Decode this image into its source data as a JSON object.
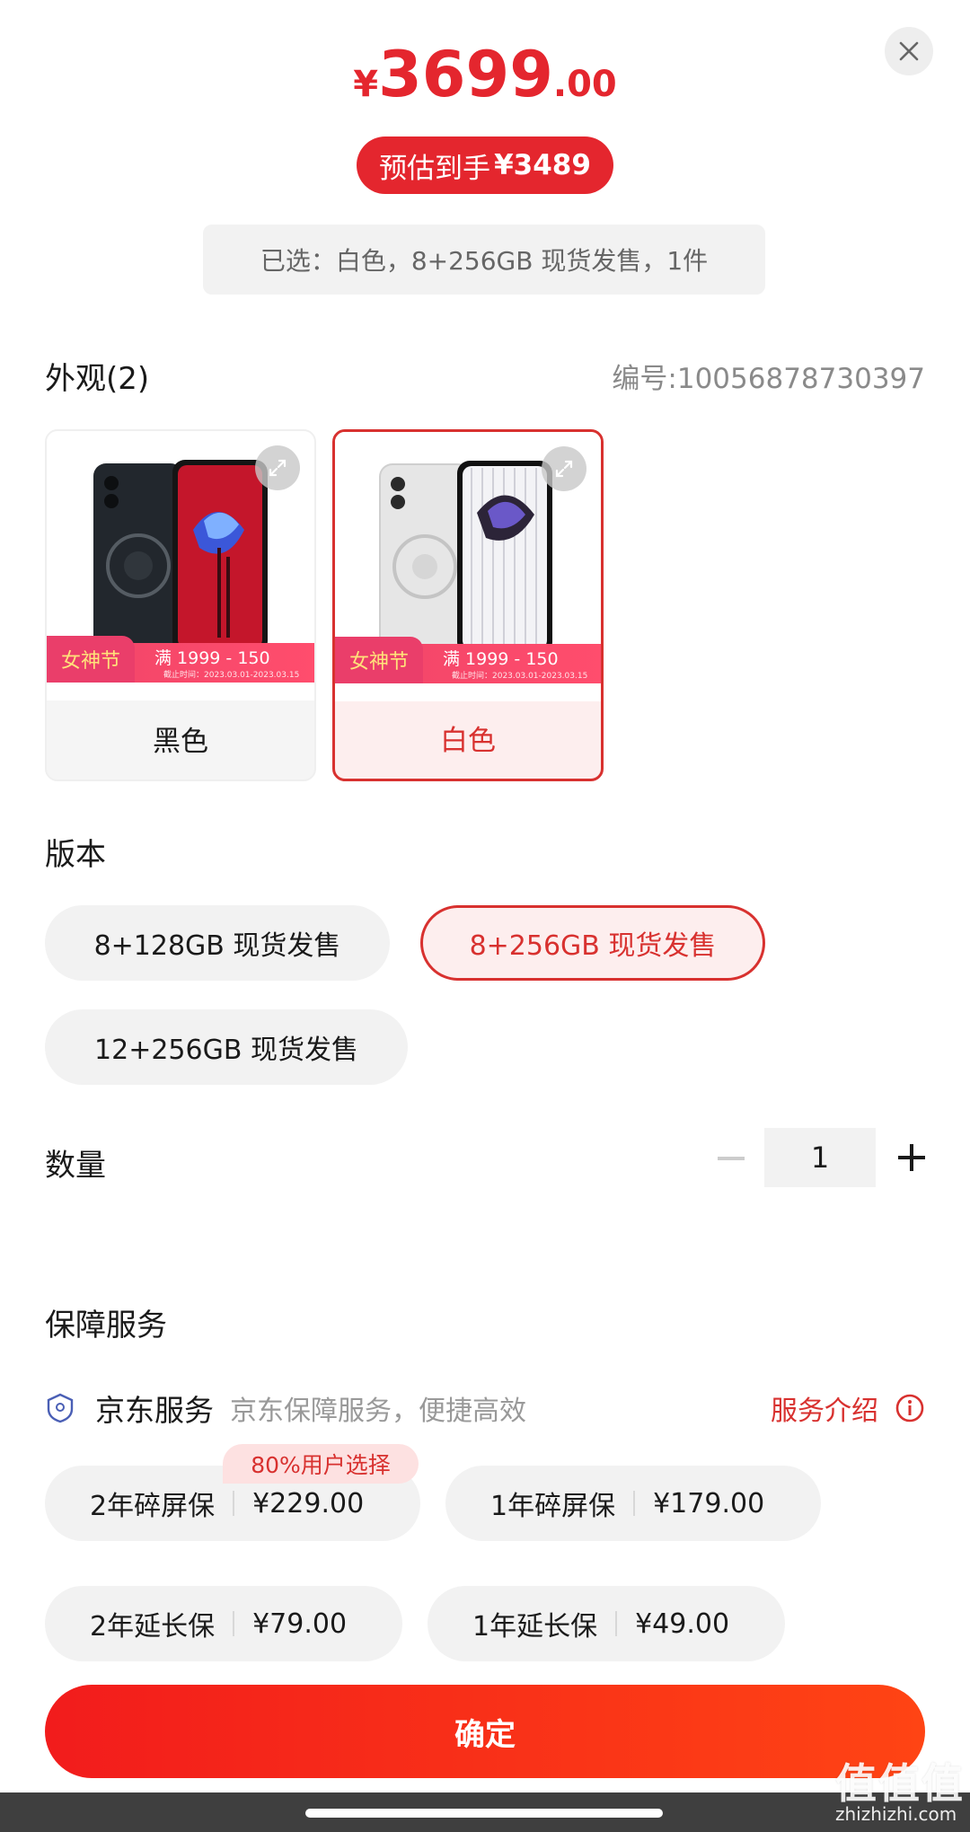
{
  "price": {
    "currency": "¥",
    "integer": "3699",
    "decimal": ".00"
  },
  "estimate": {
    "label": "预估到手",
    "value": "¥3489"
  },
  "selected_summary": "已选：白色，8+256GB 现货发售，1件",
  "appearance": {
    "title": "外观(2)",
    "sku": "编号:10056878730397",
    "options": [
      {
        "label": "黑色",
        "selected": false,
        "promo_tag": "女神节",
        "promo_deal": "满 1999 - 150",
        "promo_period": "截止时间：2023.03.01-2023.03.15"
      },
      {
        "label": "白色",
        "selected": true,
        "promo_tag": "女神节",
        "promo_deal": "满 1999 - 150",
        "promo_period": "截止时间：2023.03.01-2023.03.15"
      }
    ]
  },
  "version": {
    "title": "版本",
    "options": [
      {
        "label": "8+128GB 现货发售",
        "selected": false
      },
      {
        "label": "8+256GB 现货发售",
        "selected": true
      },
      {
        "label": "12+256GB 现货发售",
        "selected": false
      }
    ]
  },
  "quantity": {
    "title": "数量",
    "value": "1",
    "minus": "−",
    "plus": "+"
  },
  "protection": {
    "title": "保障服务",
    "service_name": "京东服务",
    "service_desc": "京东保障服务，便捷高效",
    "service_link": "服务介绍",
    "badge": "80%用户选择",
    "plans": [
      {
        "name": "2年碎屏保",
        "price": "¥229.00"
      },
      {
        "name": "1年碎屏保",
        "price": "¥179.00"
      },
      {
        "name": "2年延长保",
        "price": "¥79.00"
      },
      {
        "name": "1年延长保",
        "price": "¥49.00"
      }
    ]
  },
  "confirm_label": "确定",
  "watermark": {
    "logo": "值值值",
    "site": "zhizhizhi.com"
  },
  "colors": {
    "accent": "#e4262e",
    "selected_border": "#d8312f",
    "pill_bg": "#f2f2f2"
  }
}
